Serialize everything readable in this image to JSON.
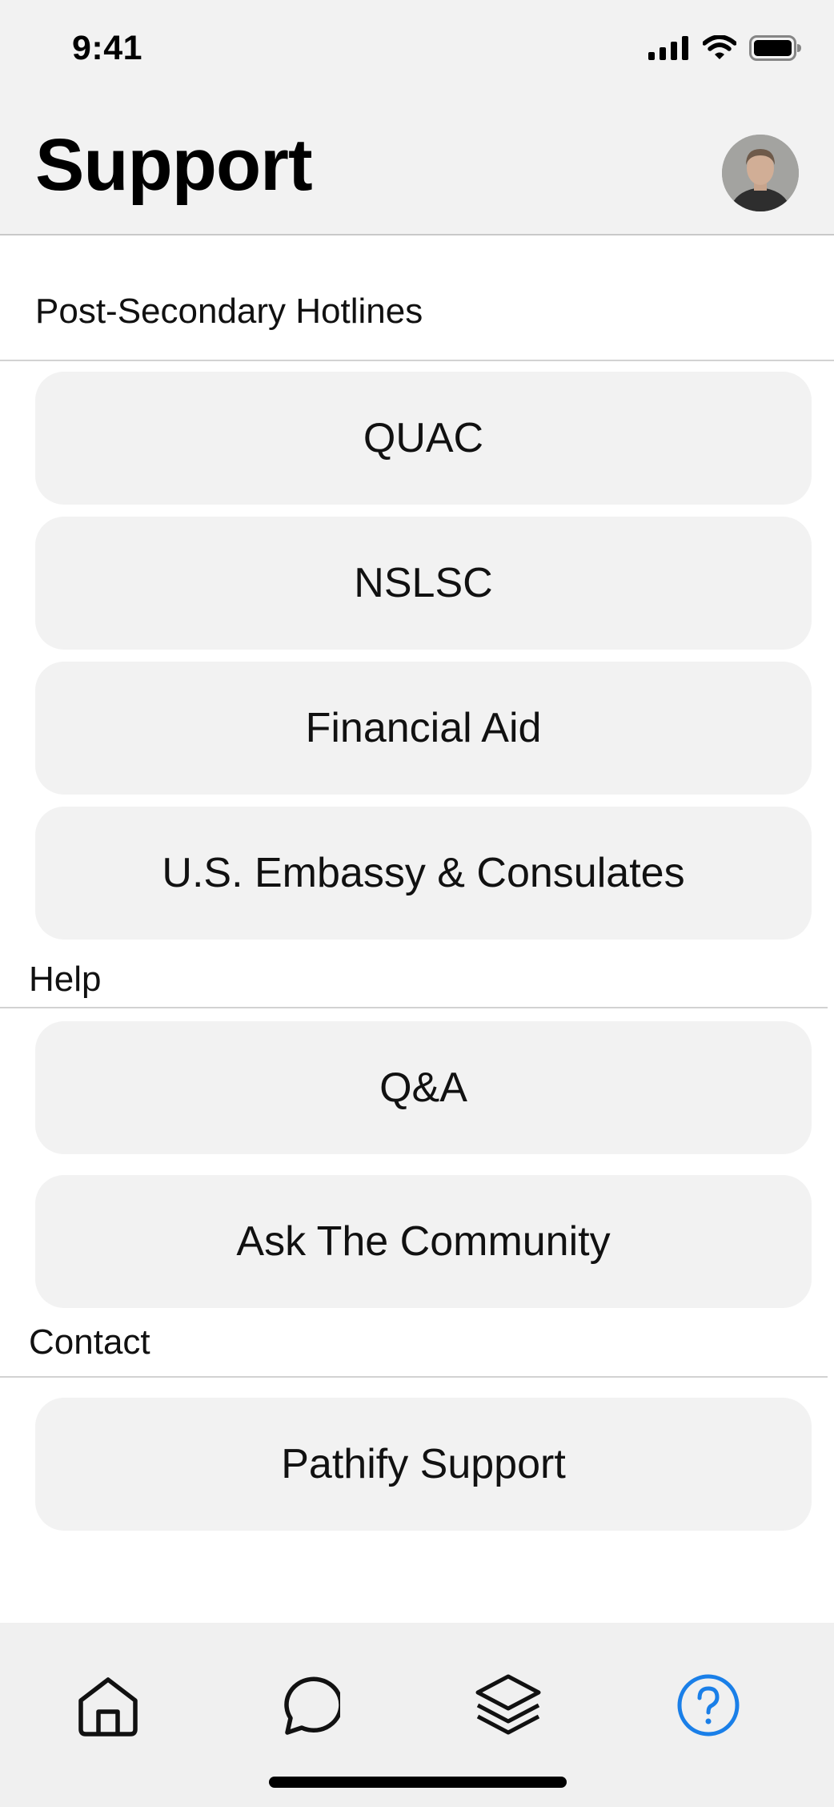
{
  "status_bar": {
    "time": "9:41"
  },
  "header": {
    "title": "Support"
  },
  "sections": {
    "hotlines": {
      "label": "Post-Secondary Hotlines",
      "buttons": [
        "QUAC",
        "NSLSC",
        "Financial Aid",
        "U.S. Embassy & Consulates"
      ]
    },
    "help": {
      "label": "Help",
      "buttons": [
        "Q&A",
        "Ask The Community"
      ]
    },
    "contact": {
      "label": "Contact",
      "buttons": [
        "Pathify Support"
      ]
    }
  },
  "tab_bar": {
    "items": [
      {
        "icon": "home-icon",
        "active": false
      },
      {
        "icon": "chat-bubble-icon",
        "active": false
      },
      {
        "icon": "layers-icon",
        "active": false
      },
      {
        "icon": "question-circle-icon",
        "active": true
      }
    ],
    "active_color": "#1a7fe8",
    "inactive_color": "#111111"
  },
  "colors": {
    "header_bg": "#f2f2f2",
    "button_bg": "#f2f2f2",
    "tabbar_bg": "#f0f0f0"
  }
}
